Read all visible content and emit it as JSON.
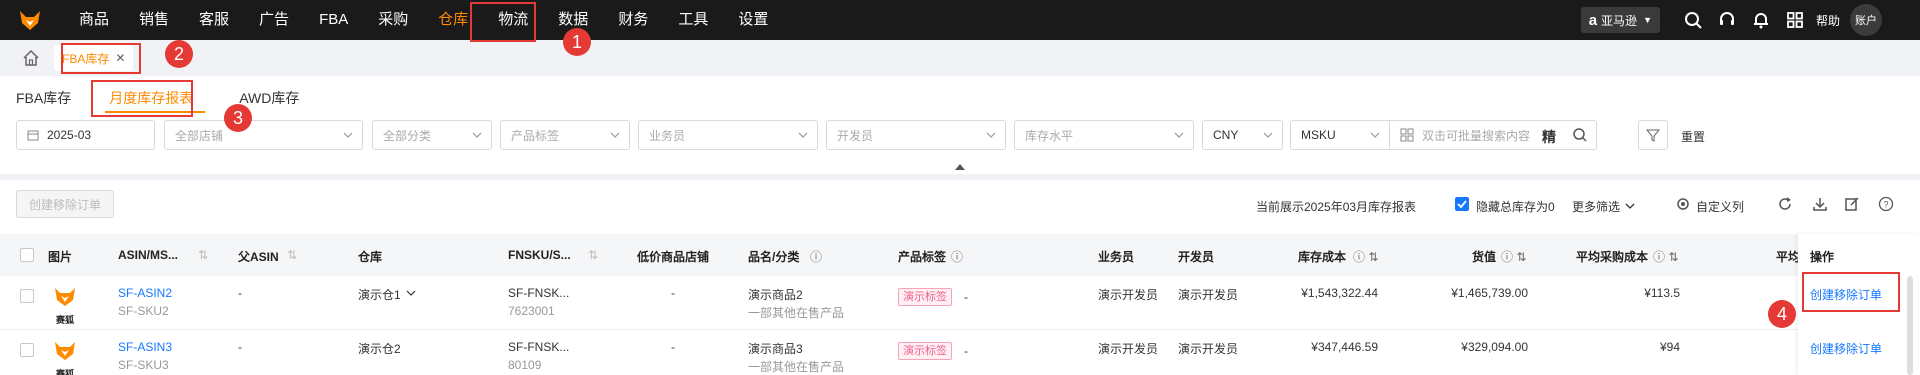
{
  "nav": {
    "items": [
      "商品",
      "销售",
      "客服",
      "广告",
      "FBA",
      "采购",
      "仓库",
      "物流",
      "数据",
      "财务",
      "工具",
      "设置"
    ],
    "active_index": 6,
    "marketplace": "亚马逊",
    "help": "帮助",
    "account": "账户"
  },
  "page_tabs": {
    "current": "FBA库存"
  },
  "sub_tabs": {
    "items": [
      "FBA库存",
      "月度库存报表",
      "AWD库存"
    ],
    "active_index": 1
  },
  "filters": {
    "month": "2025-03",
    "store_placeholder": "全部店铺",
    "category_placeholder": "全部分类",
    "tag_placeholder": "产品标签",
    "salesperson_placeholder": "业务员",
    "developer_placeholder": "开发员",
    "stock_level_placeholder": "库存水平",
    "currency": "CNY",
    "search_field": "MSKU",
    "search_placeholder": "双击可批量搜索内容",
    "exact_label": "精",
    "reset_label": "重置"
  },
  "toolbar": {
    "create_removal_label": "创建移除订单",
    "current_report_text": "当前展示2025年03月库存报表",
    "hide_zero_label": "隐藏总库存为0",
    "hide_zero_checked": true,
    "more_filters_label": "更多筛选",
    "custom_columns_label": "自定义列"
  },
  "table": {
    "headers": {
      "image": "图片",
      "asin": "ASIN/MS...",
      "parent_asin": "父ASIN",
      "warehouse": "仓库",
      "fnsku": "FNSKU/S...",
      "low_price_store": "低价商品店铺",
      "product_name": "品名/分类",
      "product_tag": "产品标签",
      "salesperson": "业务员",
      "developer": "开发员",
      "inventory_cost": "库存成本",
      "goods_value": "货值",
      "avg_purchase_cost": "平均采购成本",
      "avg_truncated": "平均",
      "ops": "操作"
    },
    "rows": [
      {
        "img_label": "赛狐",
        "asin": "SF-ASIN2",
        "msku": "SF-SKU2",
        "parent_asin": "-",
        "warehouse": "演示仓1",
        "fnsku": "SF-FNSK...",
        "fnsku_sub": "7623001",
        "low_price_store": "-",
        "product_name": "演示商品2",
        "category": "一部其他在售产品",
        "tag": "演示标签",
        "tag_suffix": "-",
        "salesperson": "演示开发员",
        "developer": "演示开发员",
        "inventory_cost": "¥1,543,322.44",
        "goods_value": "¥1,465,739.00",
        "avg_purchase_cost": "¥113.5",
        "op": "创建移除订单"
      },
      {
        "img_label": "赛狐",
        "asin": "SF-ASIN3",
        "msku": "SF-SKU3",
        "parent_asin": "-",
        "warehouse": "演示仓2",
        "fnsku": "SF-FNSK...",
        "fnsku_sub": "80109",
        "low_price_store": "-",
        "product_name": "演示商品3",
        "category": "一部其他在售产品",
        "tag": "演示标签",
        "tag_suffix": "-",
        "salesperson": "演示开发员",
        "developer": "演示开发员",
        "inventory_cost": "¥347,446.59",
        "goods_value": "¥329,094.00",
        "avg_purchase_cost": "¥94",
        "op": "创建移除订单"
      }
    ]
  },
  "annotations": [
    "1",
    "2",
    "3",
    "4"
  ],
  "colors": {
    "accent": "#ff8a00",
    "highlight": "#e53935",
    "link": "#1677ff",
    "nav_bg": "#1a1a1a"
  }
}
